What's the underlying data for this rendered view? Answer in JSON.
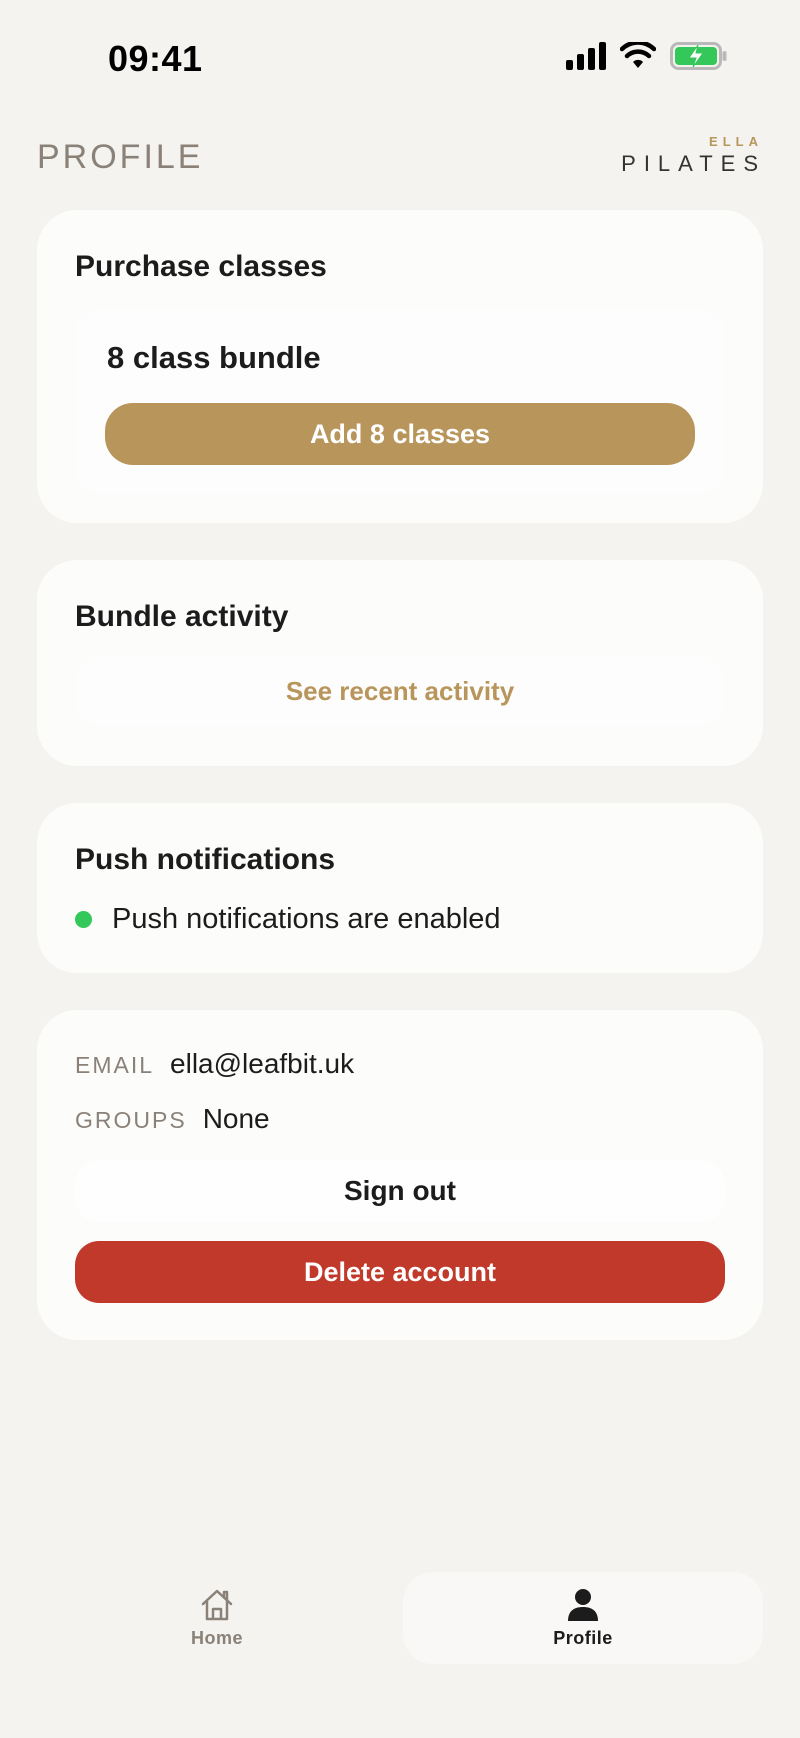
{
  "status_bar": {
    "time": "09:41",
    "icons": [
      "signal-icon",
      "wifi-icon",
      "battery-charging-icon"
    ]
  },
  "header": {
    "title": "PROFILE",
    "logo_top": "ELLA",
    "logo_main": "PILATES"
  },
  "purchase": {
    "title": "Purchase classes",
    "bundle_name": "8 class bundle",
    "button_label": "Add 8 classes"
  },
  "activity": {
    "title": "Bundle activity",
    "link_label": "See recent activity"
  },
  "notifications": {
    "title": "Push notifications",
    "status_text": "Push notifications are enabled",
    "status_color": "#34c759"
  },
  "account": {
    "email_label": "EMAIL",
    "email_value": "ella@leafbit.uk",
    "groups_label": "GROUPS",
    "groups_value": "None",
    "sign_out_label": "Sign out",
    "delete_label": "Delete account"
  },
  "tabs": [
    {
      "label": "Home",
      "icon": "home-icon",
      "active": false
    },
    {
      "label": "Profile",
      "icon": "person-icon",
      "active": true
    }
  ],
  "colors": {
    "accent": "#b8955a",
    "danger": "#c0392b",
    "background": "#f5f3f0",
    "muted": "#8a8178"
  }
}
